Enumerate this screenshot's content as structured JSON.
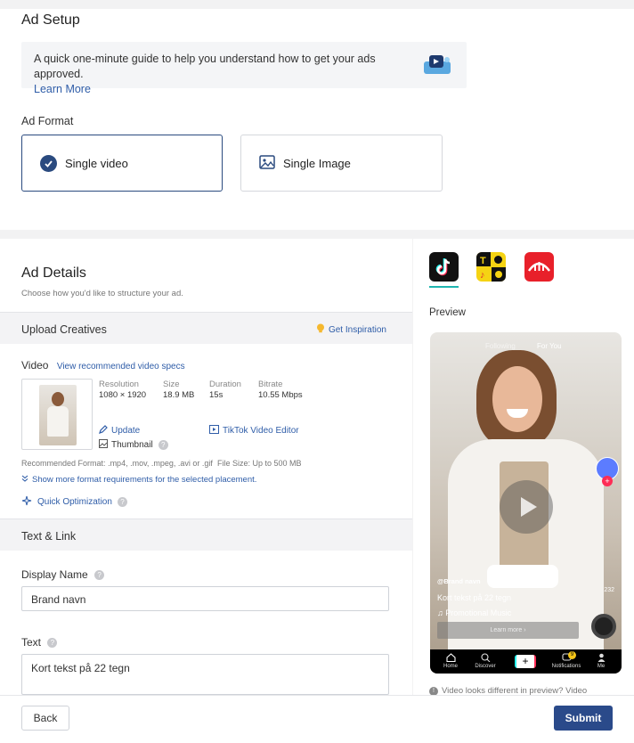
{
  "ad_setup": {
    "title": "Ad Setup",
    "guide_text": "A quick one-minute guide to help you understand how to get your ads approved.",
    "guide_link": "Learn More",
    "format_label": "Ad Format",
    "formats": [
      "Single video",
      "Single Image"
    ],
    "selected_format": "Single video"
  },
  "ad_details": {
    "title": "Ad Details",
    "subtitle": "Choose how you'd like to structure your ad."
  },
  "upload": {
    "title": "Upload Creatives",
    "inspiration": "Get Inspiration",
    "video_label": "Video",
    "view_specs": "View recommended video specs",
    "meta": {
      "resolution_label": "Resolution",
      "resolution": "1080 × 1920",
      "size_label": "Size",
      "size": "18.9 MB",
      "duration_label": "Duration",
      "duration": "15s",
      "bitrate_label": "Bitrate",
      "bitrate": "10.55 Mbps"
    },
    "update": "Update",
    "thumbnail": "Thumbnail",
    "editor": "TikTok Video Editor",
    "recommended_label": "Recommended Format:",
    "recommended_formats": ".mp4, .mov, .mpeg, .avi or .gif",
    "file_size_label": "File Size:",
    "file_size": "Up to 500 MB",
    "show_more": "Show more format requirements for the selected placement.",
    "quick_opt": "Quick Optimization"
  },
  "text_link": {
    "title": "Text & Link",
    "display_name_label": "Display Name",
    "display_name_value": "Brand navn",
    "text_label": "Text",
    "text_value": "Kort tekst på 22 tegn"
  },
  "preview": {
    "label": "Preview",
    "apps": [
      "tiktok-icon",
      "topbuzz-icon",
      "pangle-icon"
    ],
    "tabs_top": [
      "Following",
      "For You"
    ],
    "handle": "@Brand navn",
    "caption": "Kort tekst på 22 tegn",
    "music": "Promotional Music",
    "learn_more": "Learn more",
    "count": "232",
    "nav": [
      "Home",
      "Discover",
      "",
      "Notifications",
      "Me"
    ],
    "notification_badge": "9",
    "note": "Video looks different in preview? Video"
  },
  "footer": {
    "back": "Back",
    "submit": "Submit"
  },
  "colors": {
    "accent": "#2a4a8a",
    "link": "#2f5da8",
    "tiktok_bg": "#111111",
    "pangle_bg": "#e8202a"
  }
}
